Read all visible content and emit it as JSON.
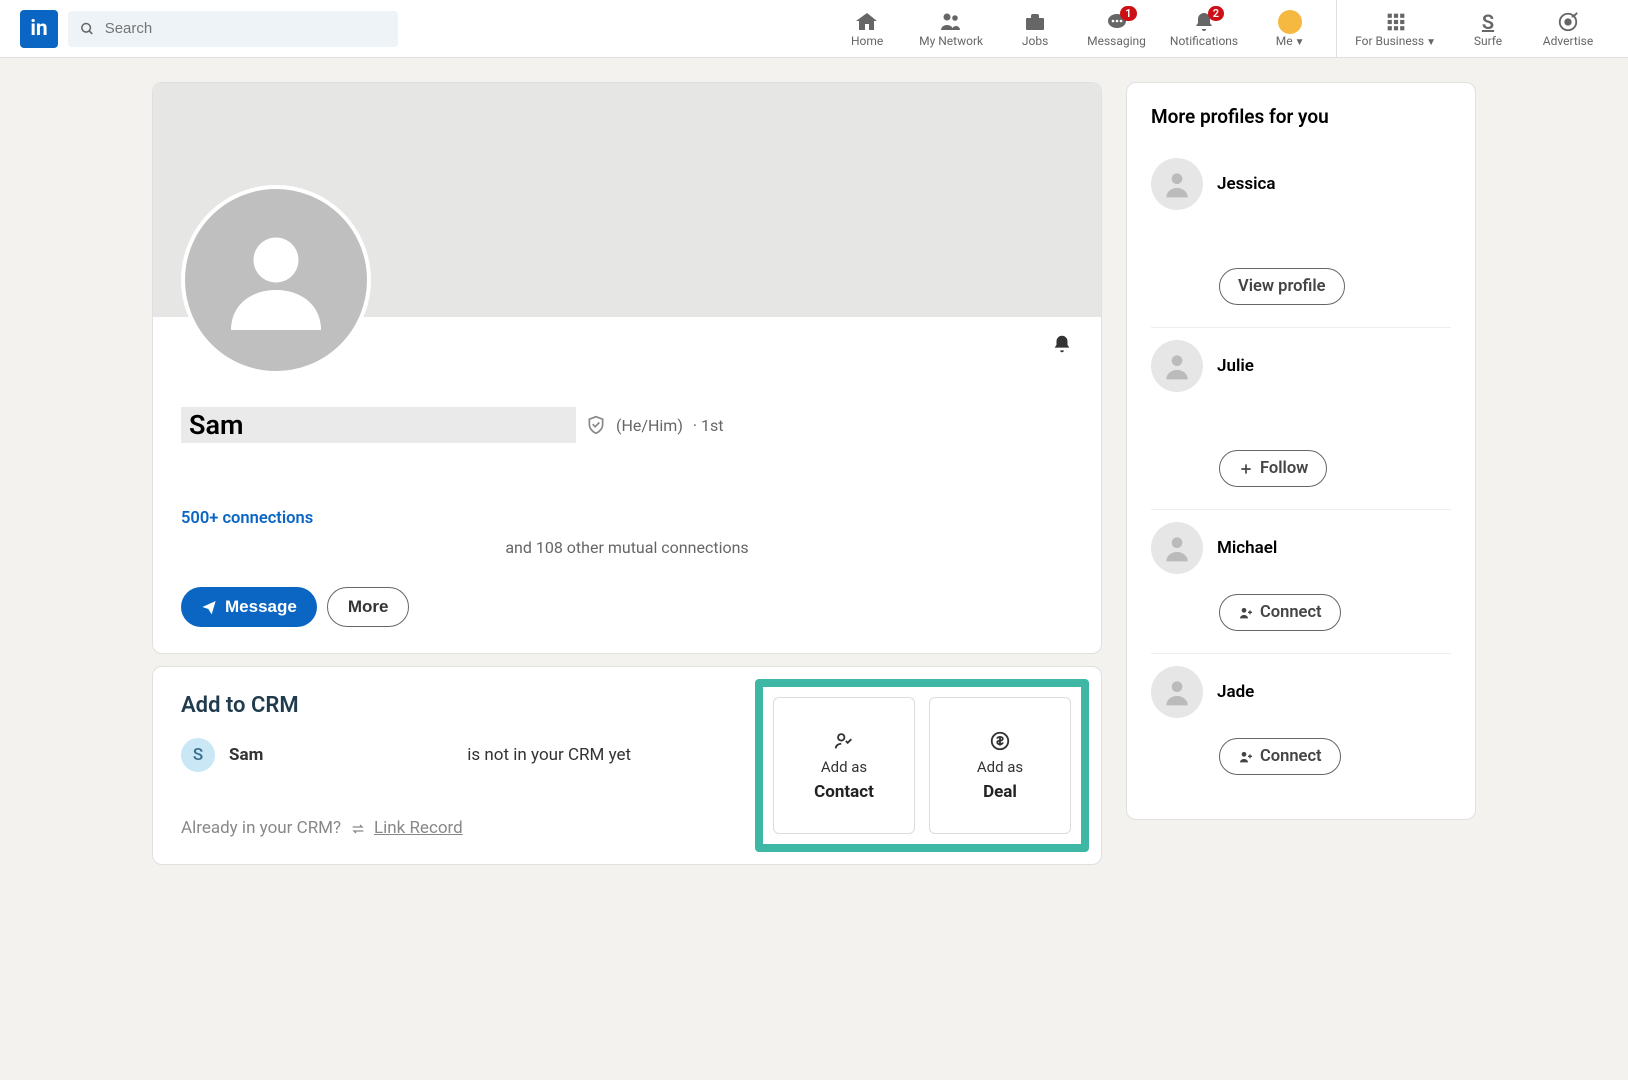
{
  "search": {
    "placeholder": "Search"
  },
  "nav": {
    "home": "Home",
    "network": "My Network",
    "jobs": "Jobs",
    "messaging": "Messaging",
    "messaging_badge": "1",
    "notifications": "Notifications",
    "notifications_badge": "2",
    "me": "Me",
    "business": "For Business",
    "surfe": "Surfe",
    "advertise": "Advertise"
  },
  "profile": {
    "name": "Sam",
    "pronouns": "(He/Him)",
    "degree": "· 1st",
    "connections": "500+ connections",
    "mutual": "and 108 other mutual connections",
    "message": "Message",
    "more": "More"
  },
  "crm": {
    "title": "Add to CRM",
    "initial": "S",
    "name": "Sam",
    "status": "is not in your CRM yet",
    "already": "Already in your CRM?",
    "link": "Link Record",
    "addas": "Add as",
    "contact": "Contact",
    "deal": "Deal"
  },
  "sidebar": {
    "title": "More profiles for you",
    "items": [
      {
        "name": "Jessica",
        "action": "View profile",
        "icon": "none"
      },
      {
        "name": "Julie",
        "action": "Follow",
        "icon": "plus"
      },
      {
        "name": "Michael",
        "action": "Connect",
        "icon": "connect",
        "short": true
      },
      {
        "name": "Jade",
        "action": "Connect",
        "icon": "connect",
        "short": true
      }
    ]
  }
}
